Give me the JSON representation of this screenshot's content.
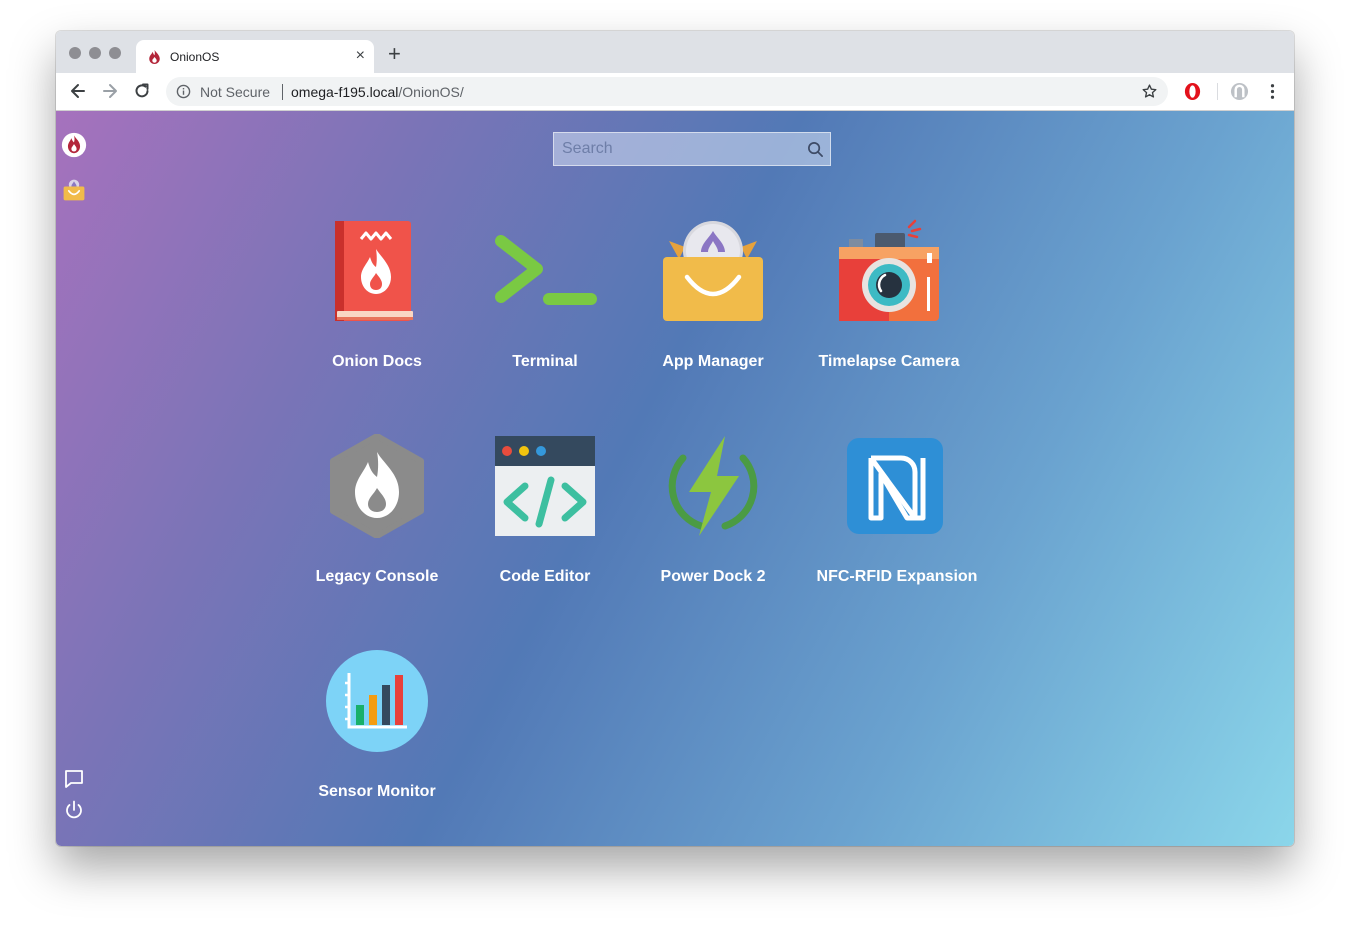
{
  "browser": {
    "tab": {
      "title": "OnionOS",
      "close_glyph": "×"
    },
    "new_tab_glyph": "+",
    "address": {
      "security_label": "Not Secure",
      "host": "omega-f195.local",
      "path": "/OnionOS/"
    }
  },
  "search": {
    "placeholder": "Search"
  },
  "sidebar": {
    "items": [
      {
        "icon": "onion-logo-icon"
      },
      {
        "icon": "app-manager-bag-icon"
      },
      {
        "icon": "chat-icon"
      },
      {
        "icon": "power-icon"
      }
    ]
  },
  "apps": [
    {
      "label": "Onion Docs",
      "icon": "onion-docs-icon"
    },
    {
      "label": "Terminal",
      "icon": "terminal-icon"
    },
    {
      "label": "App Manager",
      "icon": "app-manager-icon"
    },
    {
      "label": "Timelapse Camera",
      "icon": "timelapse-camera-icon"
    },
    {
      "label": "Legacy Console",
      "icon": "legacy-console-icon"
    },
    {
      "label": "Code Editor",
      "icon": "code-editor-icon"
    },
    {
      "label": "Power Dock 2",
      "icon": "power-dock-icon"
    },
    {
      "label": "NFC-RFID Expansion",
      "icon": "nfc-icon"
    },
    {
      "label": "Sensor Monitor",
      "icon": "sensor-monitor-icon"
    }
  ],
  "colors": {
    "docs_red": "#e8403a",
    "terminal_green": "#7ac943",
    "bag_yellow": "#f1bb4a",
    "camera_orange": "#f2703d",
    "console_gray": "#8b8b8b",
    "editor_teal": "#3dbfa0",
    "nfc_blue": "#2e8fd6",
    "sensor_cyan": "#7dd3f7"
  }
}
